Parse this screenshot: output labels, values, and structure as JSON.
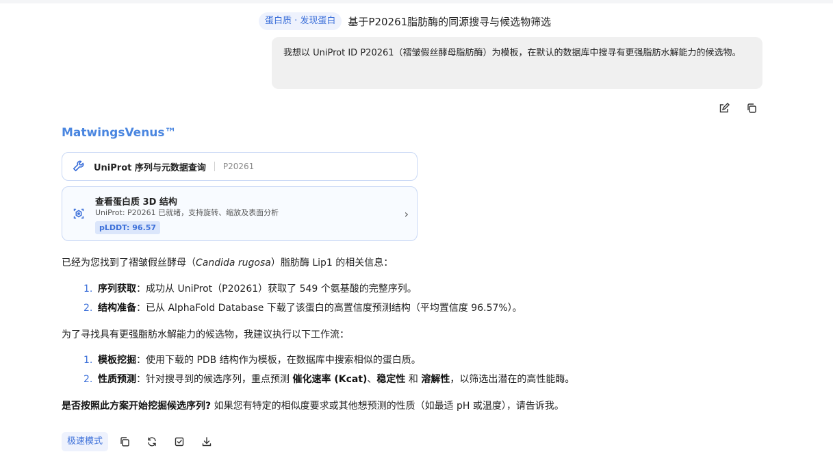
{
  "header": {
    "tag": "蛋白质 · 发现蛋白",
    "title": "基于P20261脂肪酶的同源搜寻与候选物筛选"
  },
  "user_message": {
    "text": "我想以 UniProt ID P20261（褶皱假丝酵母脂肪酶）为模板，在默认的数据库中搜寻有更强脂肪水解能力的候选物。"
  },
  "message_actions": {
    "icons": [
      "edit-icon",
      "copy-icon"
    ]
  },
  "assistant": {
    "brand": "MatwingsVenus™",
    "tool_call": {
      "label": "UniProt 序列与元数据查询",
      "arg": "P20261",
      "icon": "wrench-icon"
    },
    "structure_card": {
      "title": "查看蛋白质 3D 结构",
      "subtitle": "UniProt: P20261 已就绪，支持旋转、缩放及表面分析",
      "badge": "pLDDT: 96.57",
      "icon": "molecule-3d-icon",
      "chevron": "›"
    },
    "intro": {
      "before": "已经为您找到了褶皱假丝酵母（",
      "species": "Candida rugosa",
      "after": "）脂肪酶 Lip1 的相关信息："
    },
    "findings": [
      {
        "num": "1.",
        "title": "序列获取",
        "text": "：成功从 UniProt（P20261）获取了 549 个氨基酸的完整序列。"
      },
      {
        "num": "2.",
        "title": "结构准备",
        "text": "：已从 AlphaFold Database 下载了该蛋白的高置信度预测结构（平均置信度 96.57%）。"
      }
    ],
    "workflow_intro": "为了寻找具有更强脂肪水解能力的候选物，我建议执行以下工作流：",
    "workflow": {
      "step1": {
        "num": "1.",
        "title": "模板挖掘",
        "text": "：使用下载的 PDB 结构作为模板，在数据库中搜索相似的蛋白质。"
      },
      "step2": {
        "num": "2.",
        "title": "性质预测",
        "text_a": "：针对搜寻到的候选序列，重点预测 ",
        "bold_a": "催化速率 (Kcat)",
        "sep_a": "、",
        "bold_b": "稳定性",
        "sep_b": " 和 ",
        "bold_c": "溶解性",
        "text_b": "，以筛选出潜在的高性能酶。"
      }
    },
    "question": {
      "bold": "是否按照此方案开始挖掘候选序列?",
      "text": " 如果您有特定的相似度要求或其他想预测的性质（如最适 pH 或温度），请告诉我。"
    }
  },
  "bottom_bar": {
    "mode_label": "极速模式",
    "icons": [
      "copy-icon",
      "regenerate-icon",
      "edit-check-icon",
      "download-icon"
    ]
  },
  "colors": {
    "accent": "#3b6fd9",
    "brand": "#4a86e0",
    "bubble_bg": "#f0f0f0",
    "card_border": "#c9d8f5"
  }
}
